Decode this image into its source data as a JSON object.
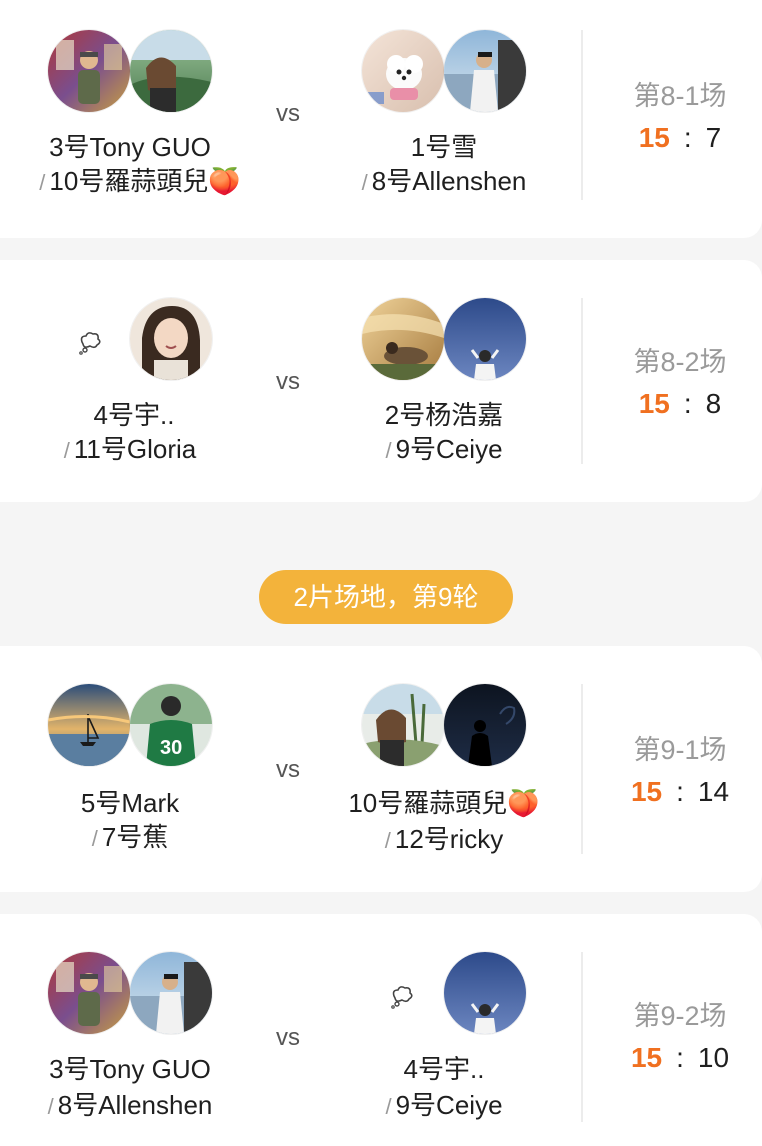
{
  "colors": {
    "background": "#f5f5f5",
    "card": "#ffffff",
    "winner_score": "#f07020",
    "round_pill": "#f3b33b",
    "round_label": "#9a9a9a"
  },
  "vs_label": "vs",
  "round_divider": "2片场地，第9轮",
  "matches": [
    {
      "round_label": "第8-1场",
      "team_a": {
        "player1": "3号Tony GUO",
        "player2": "10号羅蒜頭兒🍑"
      },
      "team_b": {
        "player1": "1号雪",
        "player2": "8号Allenshen"
      },
      "score_a": "15",
      "separator": ":",
      "score_b": "7"
    },
    {
      "round_label": "第8-2场",
      "team_a": {
        "player1": "4号宇..",
        "player2": "11号Gloria"
      },
      "team_b": {
        "player1": "2号杨浩嘉",
        "player2": "9号Ceiye"
      },
      "score_a": "15",
      "separator": ":",
      "score_b": "8"
    },
    {
      "round_label": "第9-1场",
      "team_a": {
        "player1": "5号Mark",
        "player2": "7号蕉"
      },
      "team_b": {
        "player1": "10号羅蒜頭兒🍑",
        "player2": "12号ricky"
      },
      "score_a": "15",
      "separator": ":",
      "score_b": "14"
    },
    {
      "round_label": "第9-2场",
      "team_a": {
        "player1": "3号Tony GUO",
        "player2": "8号Allenshen"
      },
      "team_b": {
        "player1": "4号宇..",
        "player2": "9号Ceiye"
      },
      "score_a": "15",
      "separator": ":",
      "score_b": "10"
    }
  ],
  "slash": "/"
}
